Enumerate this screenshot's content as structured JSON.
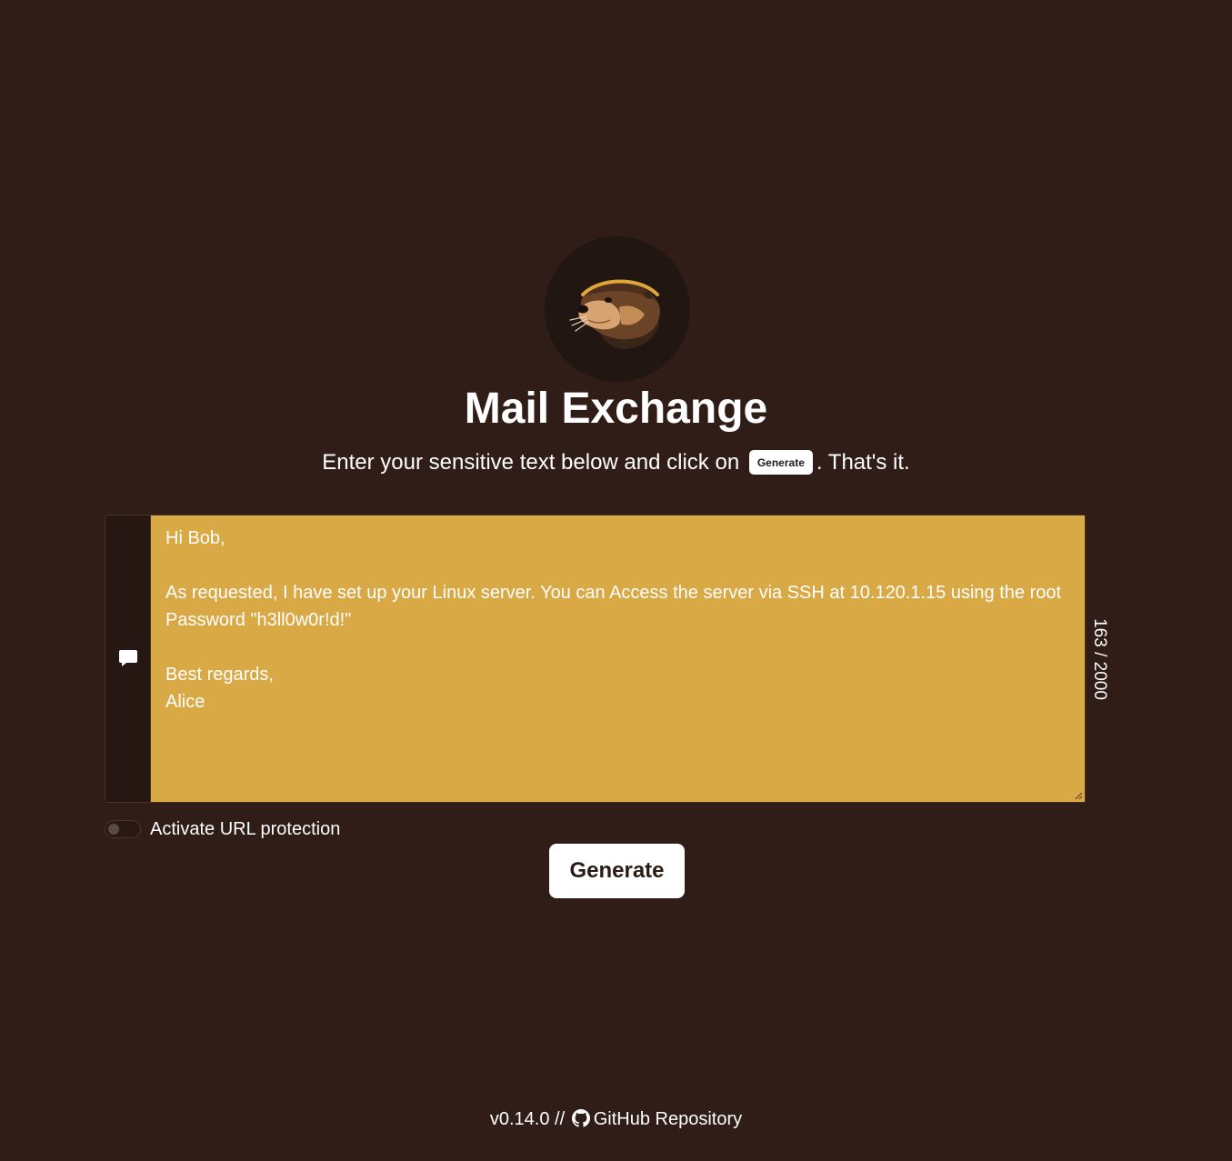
{
  "app": {
    "title": "Mail Exchange",
    "subtitle_before": "Enter your sensitive text below and click on",
    "subtitle_chip": "Generate",
    "subtitle_after": ". That's it."
  },
  "logo": {
    "icon": "otter-logo",
    "alt": "Mail Exchange otter logo"
  },
  "editor": {
    "icon": "speech-bubble-icon",
    "value": "Hi Bob,\n\nAs requested, I have set up your Linux server. You can Access the server via SSH at 10.120.1.15 using the root Password \"h3ll0w0r!d!\"\n\nBest regards,\nAlice",
    "char_count": "163 / 2000"
  },
  "options": {
    "url_protection_label": "Activate URL protection",
    "url_protection_enabled": false
  },
  "actions": {
    "generate_label": "Generate"
  },
  "footer": {
    "version": "v0.14.0 //",
    "repo_icon": "github-icon",
    "repo_label": "GitHub Repository"
  },
  "colors": {
    "background": "#311d17",
    "textarea": "#d9a946",
    "button": "#ffffff"
  }
}
